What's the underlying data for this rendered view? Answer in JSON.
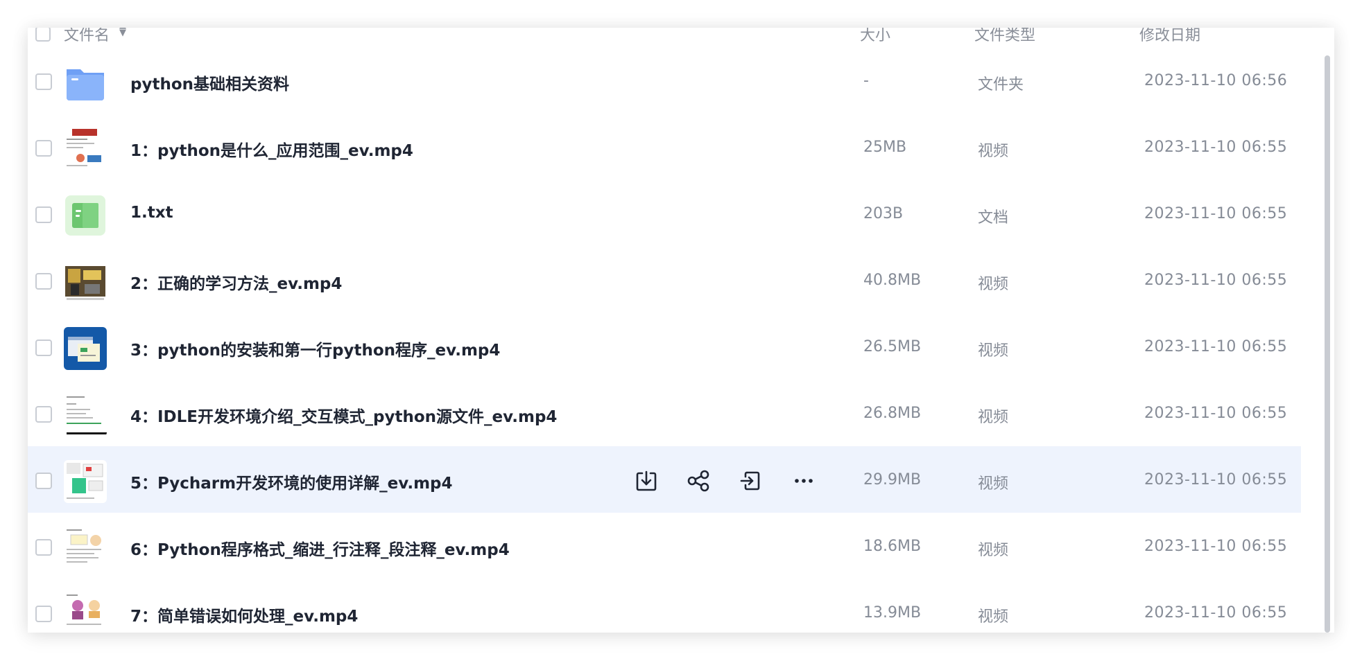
{
  "header": {
    "name": "文件名",
    "size": "大小",
    "type": "文件类型",
    "date": "修改日期"
  },
  "files": [
    {
      "name": "python基础相关资料",
      "size": "-",
      "type": "文件夹",
      "date": "2023-11-10 06:56",
      "icon": "folder-icon"
    },
    {
      "name": "1：python是什么_应用范围_ev.mp4",
      "size": "25MB",
      "type": "视频",
      "date": "2023-11-10 06:55",
      "icon": "video-thumbnail"
    },
    {
      "name": "1.txt",
      "size": "203B",
      "type": "文档",
      "date": "2023-11-10 06:55",
      "icon": "document-icon"
    },
    {
      "name": "2：正确的学习方法_ev.mp4",
      "size": "40.8MB",
      "type": "视频",
      "date": "2023-11-10 06:55",
      "icon": "video-thumbnail"
    },
    {
      "name": "3：python的安装和第一行python程序_ev.mp4",
      "size": "26.5MB",
      "type": "视频",
      "date": "2023-11-10 06:55",
      "icon": "video-thumbnail"
    },
    {
      "name": "4：IDLE开发环境介绍_交互模式_python源文件_ev.mp4",
      "size": "26.8MB",
      "type": "视频",
      "date": "2023-11-10 06:55",
      "icon": "video-thumbnail"
    },
    {
      "name": "5：Pycharm开发环境的使用详解_ev.mp4",
      "size": "29.9MB",
      "type": "视频",
      "date": "2023-11-10 06:55",
      "icon": "video-thumbnail"
    },
    {
      "name": "6：Python程序格式_缩进_行注释_段注释_ev.mp4",
      "size": "18.6MB",
      "type": "视频",
      "date": "2023-11-10 06:55",
      "icon": "video-thumbnail"
    },
    {
      "name": "7：简单错误如何处理_ev.mp4",
      "size": "13.9MB",
      "type": "视频",
      "date": "2023-11-10 06:55",
      "icon": "video-thumbnail"
    }
  ],
  "row_actions": [
    "download-icon",
    "share-icon",
    "move-icon",
    "more-icon"
  ],
  "colors": {
    "hover_row": "#eef3fd",
    "folder": "#6fa0f5",
    "doc": "#6cc66f"
  }
}
